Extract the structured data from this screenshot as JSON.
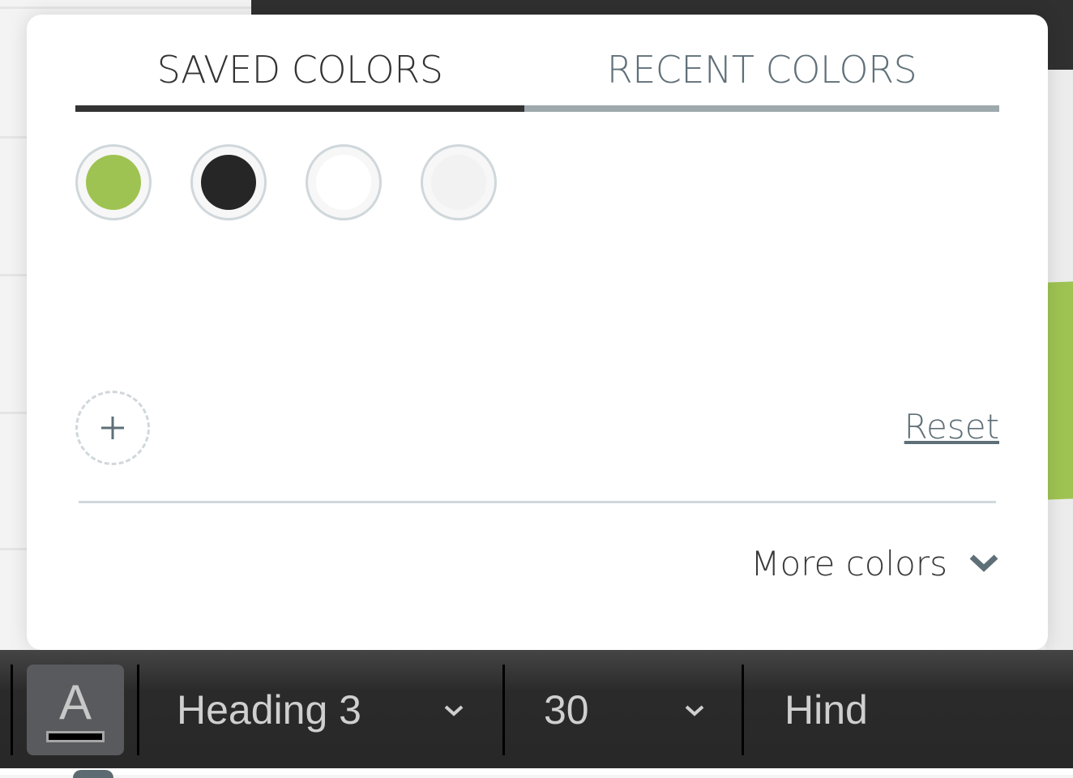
{
  "popover": {
    "tabs": [
      {
        "label": "SAVED COLORS",
        "active": true
      },
      {
        "label": "RECENT COLORS",
        "active": false
      }
    ],
    "saved_colors": [
      {
        "name": "green",
        "hex": "#9fc352"
      },
      {
        "name": "black",
        "hex": "#262626"
      },
      {
        "name": "white",
        "hex": "#ffffff"
      },
      {
        "name": "light-gray",
        "hex": "#f2f2f2"
      }
    ],
    "add_color_icon": "plus-icon",
    "reset_label": "Reset",
    "more_colors_label": "More colors",
    "more_colors_icon": "chevron-down-icon"
  },
  "toolbar": {
    "text_color_icon": "A",
    "text_color_value": "#000000",
    "style_value": "Heading 3",
    "size_value": "30",
    "font_value": "Hind"
  },
  "colors": {
    "accent_green": "#9fc352",
    "tab_active": "#333333",
    "tab_inactive": "#9ea9ae",
    "link": "#5f6f77"
  }
}
